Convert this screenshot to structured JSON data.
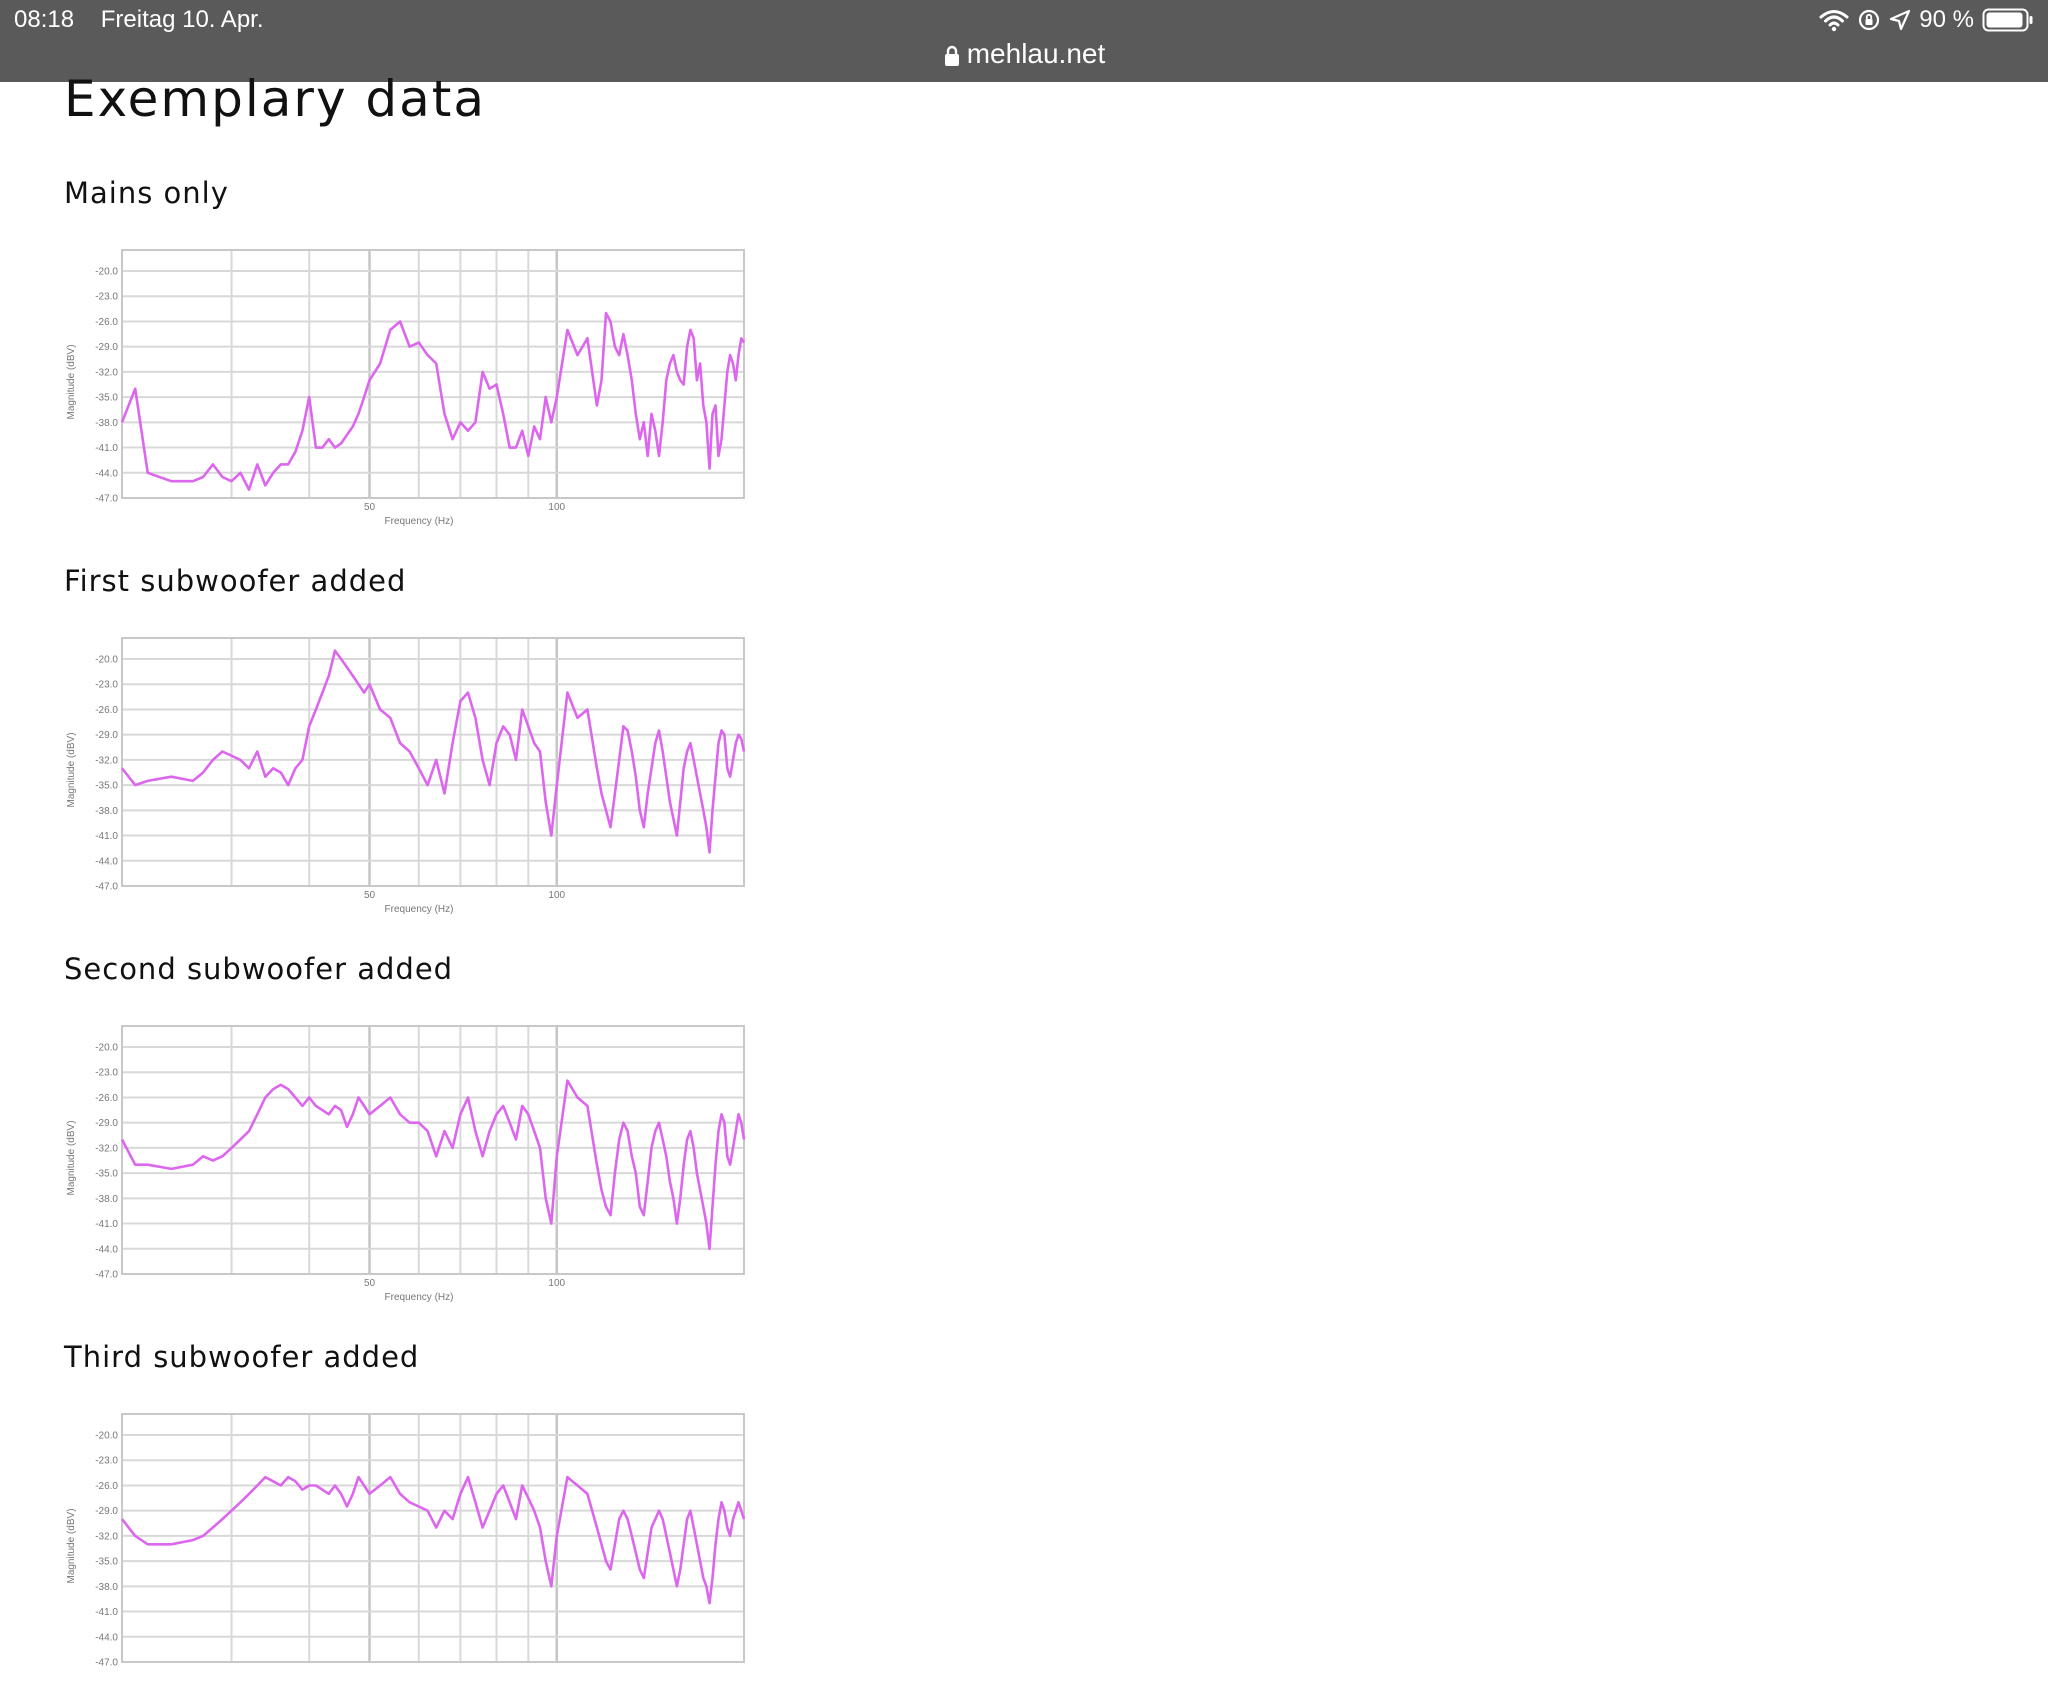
{
  "status_bar": {
    "time": "08:18",
    "date": "Freitag 10. Apr.",
    "battery": "90 %",
    "url": "mehlau.net"
  },
  "page": {
    "title": "Exemplary data"
  },
  "colors": {
    "series": "#dd66ee",
    "status_bar": "#5a5a5a"
  },
  "chart_data": [
    {
      "type": "line",
      "title": "Mains only",
      "xlabel": "Frequency (Hz)",
      "ylabel": "Magnitude (dBV)",
      "xscale": "log",
      "xlim": [
        20,
        200
      ],
      "ylim": [
        -47,
        -17.5
      ],
      "yticks": [
        "-20.0",
        "-23.0",
        "-26.0",
        "-29.0",
        "-32.0",
        "-35.0",
        "-38.0",
        "-41.0",
        "-44.0",
        "-47.0"
      ],
      "xticks": [
        "50",
        "100"
      ],
      "x": [
        20,
        21,
        22,
        24,
        26,
        27,
        28,
        29,
        30,
        31,
        32,
        33,
        34,
        35,
        36,
        37,
        38,
        39,
        40,
        41,
        42,
        43,
        44,
        45,
        46,
        47,
        48,
        49,
        50,
        52,
        54,
        56,
        58,
        60,
        62,
        64,
        66,
        68,
        70,
        72,
        74,
        76,
        78,
        80,
        82,
        84,
        86,
        88,
        90,
        92,
        94,
        96,
        98,
        100,
        104,
        108,
        112,
        116,
        118,
        120,
        122,
        124,
        126,
        128,
        130,
        132,
        134,
        136,
        138,
        140,
        142,
        144,
        146,
        148,
        150,
        152,
        154,
        156,
        158,
        160,
        162,
        164,
        166,
        168,
        170,
        172,
        174,
        176,
        178,
        180,
        182,
        184,
        186,
        188,
        190,
        192,
        194,
        196,
        198,
        200
      ],
      "values": [
        -38,
        -34,
        -44,
        -45,
        -45,
        -44.5,
        -43,
        -44.5,
        -45,
        -44,
        -46,
        -43,
        -45.5,
        -44,
        -43,
        -43,
        -41.5,
        -39,
        -35,
        -41,
        -41,
        -40,
        -41,
        -40.5,
        -39.5,
        -38.5,
        -37,
        -35,
        -33,
        -31,
        -27,
        -26,
        -29,
        -28.5,
        -30,
        -31,
        -37,
        -40,
        -38,
        -39,
        -38,
        -32,
        -34,
        -33.5,
        -37,
        -41,
        -41,
        -39,
        -42,
        -38.5,
        -40,
        -35,
        -38,
        -35,
        -27,
        -30,
        -28,
        -36,
        -33,
        -25,
        -26,
        -29,
        -30,
        -27.5,
        -30,
        -33,
        -37,
        -40,
        -38,
        -42,
        -37,
        -39,
        -42,
        -38,
        -33,
        -31,
        -30,
        -32,
        -33,
        -33.5,
        -29,
        -27,
        -28,
        -33,
        -31,
        -36,
        -38,
        -43.5,
        -37,
        -36,
        -42,
        -40,
        -36,
        -32,
        -30,
        -31,
        -33,
        -30,
        -28,
        -28.5
      ]
    },
    {
      "type": "line",
      "title": "First subwoofer added",
      "xlabel": "Frequency (Hz)",
      "ylabel": "Magnitude (dBV)",
      "xscale": "log",
      "xlim": [
        20,
        200
      ],
      "ylim": [
        -47,
        -17.5
      ],
      "yticks": [
        "-20.0",
        "-23.0",
        "-26.0",
        "-29.0",
        "-32.0",
        "-35.0",
        "-38.0",
        "-41.0",
        "-44.0",
        "-47.0"
      ],
      "xticks": [
        "50",
        "100"
      ],
      "x": [
        20,
        21,
        22,
        24,
        26,
        27,
        28,
        29,
        30,
        31,
        32,
        33,
        34,
        35,
        36,
        37,
        38,
        39,
        40,
        41,
        42,
        43,
        44,
        45,
        46,
        47,
        48,
        49,
        50,
        52,
        54,
        56,
        58,
        60,
        62,
        64,
        66,
        68,
        70,
        72,
        74,
        76,
        78,
        80,
        82,
        84,
        86,
        88,
        90,
        92,
        94,
        96,
        98,
        100,
        104,
        108,
        112,
        116,
        118,
        120,
        122,
        124,
        126,
        128,
        130,
        132,
        134,
        136,
        138,
        140,
        142,
        144,
        146,
        148,
        150,
        152,
        154,
        156,
        158,
        160,
        162,
        164,
        166,
        168,
        170,
        172,
        174,
        176,
        178,
        180,
        182,
        184,
        186,
        188,
        190,
        192,
        194,
        196,
        198,
        200
      ],
      "values": [
        -33,
        -35,
        -34.5,
        -34,
        -34.5,
        -33.5,
        -32,
        -31,
        -31.5,
        -32,
        -33,
        -31,
        -34,
        -33,
        -33.5,
        -35,
        -33,
        -32,
        -28,
        -26,
        -24,
        -22,
        -19,
        -20,
        -21,
        -22,
        -23,
        -24,
        -23,
        -26,
        -27,
        -30,
        -31,
        -33,
        -35,
        -32,
        -36,
        -30,
        -25,
        -24,
        -27,
        -32,
        -35,
        -30,
        -28,
        -29,
        -32,
        -26,
        -28,
        -30,
        -31,
        -37,
        -41,
        -35,
        -24,
        -27,
        -26,
        -33,
        -36,
        -38,
        -40,
        -36,
        -32,
        -28,
        -28.5,
        -31,
        -34,
        -38,
        -40,
        -36,
        -33,
        -30,
        -28.5,
        -31,
        -34,
        -37,
        -39,
        -41,
        -37,
        -33,
        -31,
        -30,
        -32,
        -34,
        -36,
        -38,
        -40,
        -43,
        -38,
        -34,
        -30,
        -28.5,
        -29,
        -33,
        -34,
        -32,
        -30,
        -29,
        -29.5,
        -31
      ]
    },
    {
      "type": "line",
      "title": "Second subwoofer added",
      "xlabel": "Frequency (Hz)",
      "ylabel": "Magnitude (dBV)",
      "xscale": "log",
      "xlim": [
        20,
        200
      ],
      "ylim": [
        -47,
        -17.5
      ],
      "yticks": [
        "-20.0",
        "-23.0",
        "-26.0",
        "-29.0",
        "-32.0",
        "-35.0",
        "-38.0",
        "-41.0",
        "-44.0",
        "-47.0"
      ],
      "xticks": [
        "50",
        "100"
      ],
      "x": [
        20,
        21,
        22,
        24,
        26,
        27,
        28,
        29,
        30,
        31,
        32,
        33,
        34,
        35,
        36,
        37,
        38,
        39,
        40,
        41,
        42,
        43,
        44,
        45,
        46,
        47,
        48,
        49,
        50,
        52,
        54,
        56,
        58,
        60,
        62,
        64,
        66,
        68,
        70,
        72,
        74,
        76,
        78,
        80,
        82,
        84,
        86,
        88,
        90,
        92,
        94,
        96,
        98,
        100,
        104,
        108,
        112,
        116,
        118,
        120,
        122,
        124,
        126,
        128,
        130,
        132,
        134,
        136,
        138,
        140,
        142,
        144,
        146,
        148,
        150,
        152,
        154,
        156,
        158,
        160,
        162,
        164,
        166,
        168,
        170,
        172,
        174,
        176,
        178,
        180,
        182,
        184,
        186,
        188,
        190,
        192,
        194,
        196,
        198,
        200
      ],
      "values": [
        -31,
        -34,
        -34,
        -34.5,
        -34,
        -33,
        -33.5,
        -33,
        -32,
        -31,
        -30,
        -28,
        -26,
        -25,
        -24.5,
        -25,
        -26,
        -27,
        -26,
        -27,
        -27.5,
        -28,
        -27,
        -27.5,
        -29.5,
        -28,
        -26,
        -27,
        -28,
        -27,
        -26,
        -28,
        -29,
        -29,
        -30,
        -33,
        -30,
        -32,
        -28,
        -26,
        -30,
        -33,
        -30,
        -28,
        -27,
        -29,
        -31,
        -27,
        -28,
        -30,
        -32,
        -38,
        -41,
        -33,
        -24,
        -26,
        -27,
        -34,
        -37,
        -39,
        -40,
        -35,
        -31,
        -29,
        -30,
        -33,
        -35,
        -39,
        -40,
        -36,
        -32,
        -30,
        -29,
        -31,
        -33,
        -36,
        -38,
        -41,
        -38,
        -34,
        -31,
        -30,
        -32,
        -35,
        -37,
        -39,
        -41,
        -44,
        -39,
        -34,
        -30,
        -28,
        -29,
        -33,
        -34,
        -32,
        -30,
        -28,
        -29,
        -31
      ]
    },
    {
      "type": "line",
      "title": "Third subwoofer added",
      "xlabel": "",
      "ylabel": "Magnitude (dBV)",
      "xscale": "log",
      "xlim": [
        20,
        200
      ],
      "ylim": [
        -47,
        -17.5
      ],
      "yticks": [
        "-20.0",
        "-23.0",
        "-26.0",
        "-29.0",
        "-32.0",
        "-35.0",
        "-38.0",
        "-41.0",
        "-44.0",
        "-47.0"
      ],
      "xticks": [],
      "x": [
        20,
        21,
        22,
        24,
        26,
        27,
        28,
        29,
        30,
        31,
        32,
        33,
        34,
        35,
        36,
        37,
        38,
        39,
        40,
        41,
        42,
        43,
        44,
        45,
        46,
        47,
        48,
        49,
        50,
        52,
        54,
        56,
        58,
        60,
        62,
        64,
        66,
        68,
        70,
        72,
        74,
        76,
        78,
        80,
        82,
        84,
        86,
        88,
        90,
        92,
        94,
        96,
        98,
        100,
        104,
        108,
        112,
        116,
        118,
        120,
        122,
        124,
        126,
        128,
        130,
        132,
        134,
        136,
        138,
        140,
        142,
        144,
        146,
        148,
        150,
        152,
        154,
        156,
        158,
        160,
        162,
        164,
        166,
        168,
        170,
        172,
        174,
        176,
        178,
        180,
        182,
        184,
        186,
        188,
        190,
        192,
        194,
        196,
        198,
        200
      ],
      "values": [
        -30,
        -32,
        -33,
        -33,
        -32.5,
        -32,
        -31,
        -30,
        -29,
        -28,
        -27,
        -26,
        -25,
        -25.5,
        -26,
        -25,
        -25.5,
        -26.5,
        -26,
        -26,
        -26.5,
        -27,
        -26,
        -27,
        -28.5,
        -27,
        -25,
        -26,
        -27,
        -26,
        -25,
        -27,
        -28,
        -28.5,
        -29,
        -31,
        -29,
        -30,
        -27,
        -25,
        -28,
        -31,
        -29,
        -27,
        -26,
        -28,
        -30,
        -26,
        -27.5,
        -29,
        -31,
        -35,
        -38,
        -32,
        -25,
        -26,
        -27,
        -31,
        -33,
        -35,
        -36,
        -33,
        -30,
        -29,
        -30,
        -32,
        -34,
        -36,
        -37,
        -34,
        -31,
        -30,
        -29,
        -30,
        -32,
        -34,
        -36,
        -38,
        -36,
        -33,
        -30,
        -29,
        -31,
        -33,
        -35,
        -37,
        -38,
        -40,
        -37,
        -33,
        -30,
        -28,
        -29,
        -31,
        -32,
        -30,
        -29,
        -28,
        -29,
        -30
      ]
    }
  ]
}
